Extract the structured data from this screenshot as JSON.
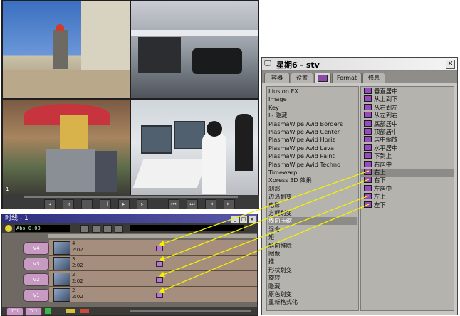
{
  "palette": {
    "title": "星期6 - stv",
    "close_label": "✕",
    "tabs": [
      {
        "label": "容器"
      },
      {
        "label": "设置"
      },
      {
        "label": ""
      },
      {
        "label": "Format"
      },
      {
        "label": "修息"
      }
    ],
    "categories": [
      "Illusion FX",
      "Image",
      "Key",
      "L- 隐藏",
      "PlasmaWipe Avid Borders",
      "PlasmaWipe Avid Center",
      "PlasmaWipe Avid Horiz",
      "PlasmaWipe Avid Lava",
      "PlasmaWipe Avid Paint",
      "PlasmaWipe Avid Techno",
      "Timewarp",
      "Xpress 3D 效果",
      "刹那",
      "边沿划变",
      "电影",
      "方框划变",
      "横向压缩",
      "混合",
      "矩",
      "斜向推除",
      "图像",
      "推",
      "形状划变",
      "旋转",
      "隐藏",
      "原色划变",
      "重新格式化"
    ],
    "selected_category_index": 16,
    "effects": [
      "垂直居中",
      "从上到下",
      "从右到左",
      "从左到右",
      "底部居中",
      "顶部居中",
      "居中缩放",
      "水平居中",
      "下到上",
      "右居中",
      "右上",
      "右下",
      "左居中",
      "左上",
      "左下"
    ],
    "selected_effect_index": 10
  },
  "timeline": {
    "title": "时线 - 1",
    "timecode": "Abs              0:00",
    "tracks": [
      {
        "label": "V4",
        "clip_name": "4",
        "clip_duration": "2:02"
      },
      {
        "label": "V3",
        "clip_name": "3",
        "clip_duration": "2:02"
      },
      {
        "label": "V2",
        "clip_name": "2",
        "clip_duration": "2:02"
      },
      {
        "label": "V1",
        "clip_name": "2",
        "clip_duration": "2:02"
      }
    ],
    "bottom_buttons": [
      "TC1",
      "TC2"
    ]
  },
  "monitor": {
    "timecode_marker": "1"
  },
  "colors": {
    "effect_icon": "#9a4ac0",
    "arrow": "#f2f200",
    "track_label": "#c79ac2",
    "clip_lane": "#a58e7d"
  }
}
